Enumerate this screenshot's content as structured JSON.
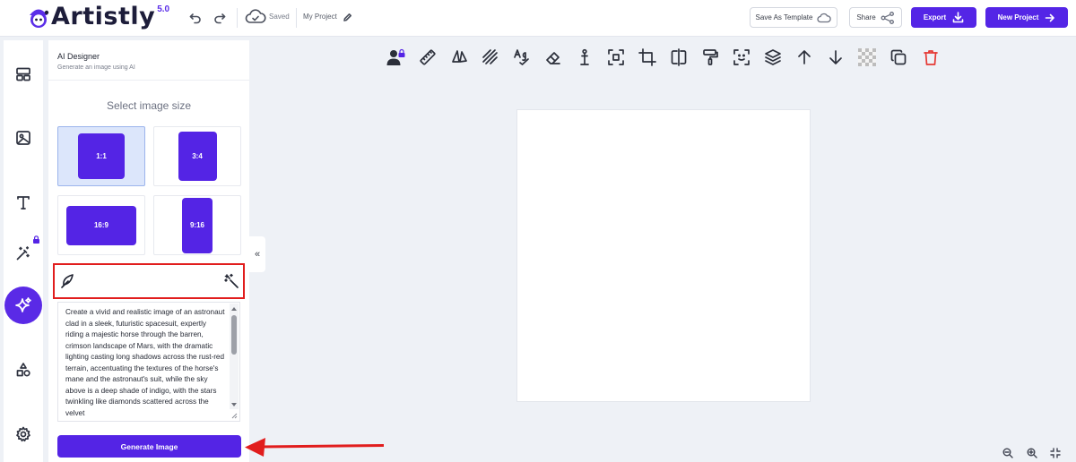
{
  "app": {
    "logo_text": "Artistly",
    "logo_version": "5.0",
    "saved_status": "Saved",
    "project_name": "My Project"
  },
  "header_buttons": {
    "save_as_template": "Save As Template",
    "share": "Share",
    "export": "Export",
    "new_project": "New Project"
  },
  "colors": {
    "accent": "#5424e5",
    "highlight_red": "#e11d1d",
    "selected_card_bg": "#dce6fb",
    "delete_red": "#e53935"
  },
  "rail": {
    "items": [
      {
        "icon": "layout-icon",
        "locked": false
      },
      {
        "icon": "image-icon",
        "locked": false
      },
      {
        "icon": "text-icon",
        "locked": false
      },
      {
        "icon": "magic-wand-icon",
        "locked": true
      },
      {
        "icon": "sparkles-icon",
        "locked": false,
        "active": true
      },
      {
        "icon": "shapes-icon",
        "locked": false
      },
      {
        "icon": "settings-icon",
        "locked": false
      }
    ]
  },
  "panel": {
    "title": "AI Designer",
    "subtitle": "Generate an image using AI",
    "size_heading": "Select image size",
    "sizes": [
      {
        "label": "1:1",
        "selected": true
      },
      {
        "label": "3:4",
        "selected": false
      },
      {
        "label": "16:9",
        "selected": false
      },
      {
        "label": "9:16",
        "selected": false
      }
    ],
    "prompt_text": "Create a vivid and realistic image of an astronaut clad in a sleek, futuristic spacesuit, expertly riding a majestic horse through the barren, crimson landscape of Mars, with the dramatic lighting casting long shadows across the rust-red terrain, accentuating the textures of the horse's mane and the astronaut's suit, while the sky above is a deep shade of indigo, with the stars twinkling like diamonds scattered across the velvet",
    "generate_label": "Generate Image",
    "collapse_glyph": "«"
  },
  "toolbar": {
    "tools": [
      "user-lock-icon",
      "ruler-icon",
      "flip-icon",
      "stripes-icon",
      "spellcheck-icon",
      "eraser-icon",
      "anchor-icon",
      "resize-icon",
      "crop-icon",
      "mirror-icon",
      "paint-roller-icon",
      "focus-icon",
      "layers-icon",
      "arrow-up-icon",
      "arrow-down-icon",
      "transparency-icon",
      "duplicate-icon",
      "trash-icon"
    ]
  },
  "zoom": {
    "icons": [
      "zoom-out-icon",
      "zoom-in-icon",
      "fit-screen-icon"
    ]
  }
}
